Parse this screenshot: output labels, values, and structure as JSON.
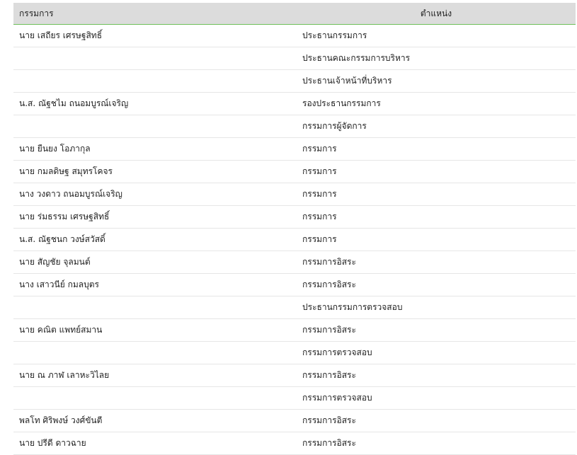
{
  "table": {
    "headers": {
      "name": "กรรมการ",
      "position": "ตำแหน่ง"
    },
    "rows": [
      {
        "name": "นาย เสถียร เศรษฐสิทธิ์",
        "position": "ประธานกรรมการ"
      },
      {
        "name": "",
        "position": "ประธานคณะกรรมการบริหาร"
      },
      {
        "name": "",
        "position": "ประธานเจ้าหน้าที่บริหาร"
      },
      {
        "name": "น.ส. ณัฐชไม ถนอมบูรณ์เจริญ",
        "position": "รองประธานกรรมการ"
      },
      {
        "name": "",
        "position": "กรรมการผู้จัดการ"
      },
      {
        "name": "นาย ยืนยง โอภากุล",
        "position": "กรรมการ"
      },
      {
        "name": "นาย กมลดิษฐ สมุทรโคจร",
        "position": "กรรมการ"
      },
      {
        "name": "นาง วงดาว ถนอมบูรณ์เจริญ",
        "position": "กรรมการ"
      },
      {
        "name": "นาย ร่มธรรม เศรษฐสิทธิ์",
        "position": "กรรมการ"
      },
      {
        "name": "น.ส. ณัฐชนก วงษ์สวัสดิ์",
        "position": "กรรมการ"
      },
      {
        "name": "นาย สัญชัย จุลมนต์",
        "position": "กรรมการอิสระ"
      },
      {
        "name": "นาง เสาวนีย์ กมลบุตร",
        "position": "กรรมการอิสระ"
      },
      {
        "name": "",
        "position": "ประธานกรรมการตรวจสอบ"
      },
      {
        "name": "นาย คณิต แพทย์สมาน",
        "position": "กรรมการอิสระ"
      },
      {
        "name": "",
        "position": "กรรมการตรวจสอบ"
      },
      {
        "name": "นาย ณ ภาฬ เลาหะวิไลย",
        "position": "กรรมการอิสระ"
      },
      {
        "name": "",
        "position": "กรรมการตรวจสอบ"
      },
      {
        "name": "พลโท ศิริพงษ์ วงศ์ขันตี",
        "position": "กรรมการอิสระ"
      },
      {
        "name": "นาย ปรีดี ดาวฉาย",
        "position": "กรรมการอิสระ"
      }
    ]
  },
  "colors": {
    "header_bg": "#dcdcdc",
    "header_border": "#6fbf5a",
    "row_border": "#e6e6e6",
    "text": "#222222"
  }
}
